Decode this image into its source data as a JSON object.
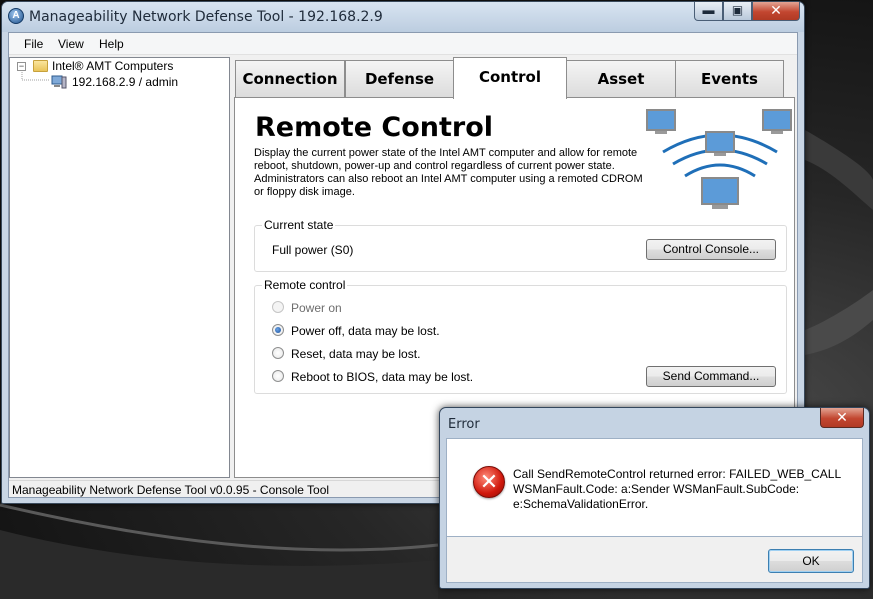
{
  "window": {
    "title": "Manageability Network Defense Tool - 192.168.2.9",
    "controls": {
      "minimize": "▬",
      "maximize": "▣",
      "close": "✕"
    }
  },
  "menu": [
    "File",
    "View",
    "Help"
  ],
  "tree": {
    "root": "Intel® AMT Computers",
    "expander": "−",
    "child": "192.168.2.9 / admin"
  },
  "tabs": [
    "Connection",
    "Defense",
    "Control",
    "Asset",
    "Events"
  ],
  "active_tab": "Control",
  "panel": {
    "title": "Remote Control",
    "description": "Display the current power state of the Intel AMT computer and allow for remote reboot, shutdown, power-up and control regardless of current power state. Administrators can also reboot an Intel AMT computer using a remoted CDROM or floppy disk image.",
    "current_state": {
      "label": "Current state",
      "value": "Full power (S0)",
      "button": "Control Console..."
    },
    "remote_control": {
      "label": "Remote control",
      "options": [
        "Power on",
        "Power off, data may be lost.",
        "Reset, data may be lost.",
        "Reboot to BIOS, data may be lost."
      ],
      "selected": "Power off, data may be lost.",
      "disabled": "Power on",
      "button": "Send Command..."
    }
  },
  "status_bar": "Manageability Network Defense Tool v0.0.95 - Console Tool",
  "dialog": {
    "title": "Error",
    "close": "✕",
    "icon": "error-icon",
    "message": "Call SendRemoteControl returned error: FAILED_WEB_CALL WSManFault.Code: a:Sender WSManFault.SubCode: e:SchemaValidationError.",
    "ok": "OK"
  },
  "colors": {
    "titlebar": "#c9d6e5",
    "close_button": "#c24630",
    "error_red": "#d0180c",
    "radio_selected": "#1b4f9a"
  }
}
